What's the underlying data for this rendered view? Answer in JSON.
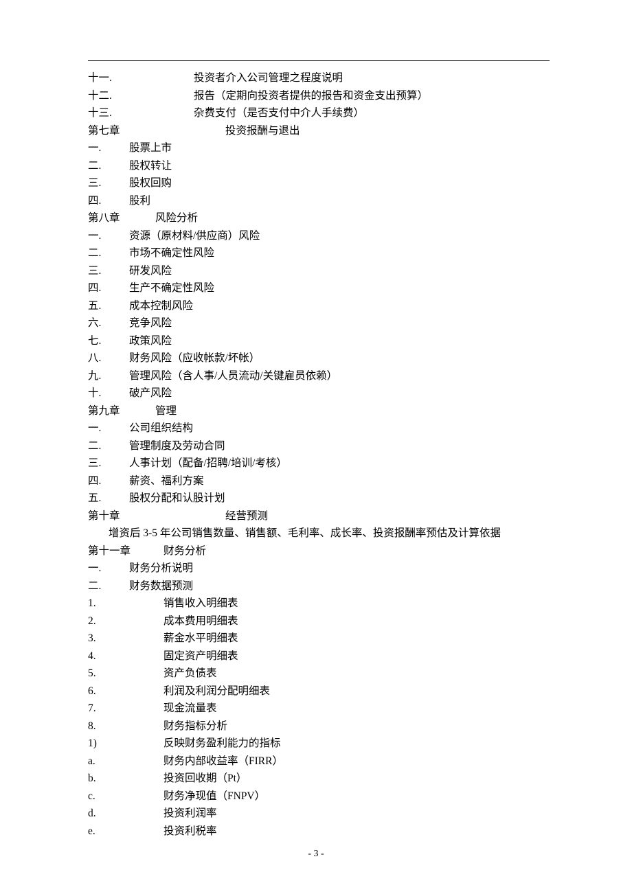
{
  "lines": [
    {
      "num": "十一.",
      "numClass": "wide-num",
      "text": "投资者介入公司管理之程度说明"
    },
    {
      "num": "十二.",
      "numClass": "wide-num",
      "text": "报告（定期向投资者提供的报告和资金支出预算）"
    },
    {
      "num": "十三.",
      "numClass": "wide-num",
      "text": "杂费支付（是否支付中介人手续费）"
    },
    {
      "num": "第七章",
      "numClass": "chapter-lbl",
      "text": "投资报酬与退出"
    },
    {
      "num": "一.",
      "numClass": "num",
      "text": "股票上市"
    },
    {
      "num": "二.",
      "numClass": "num",
      "text": "股权转让"
    },
    {
      "num": "三.",
      "numClass": "num",
      "text": "股权回购"
    },
    {
      "num": "四.",
      "numClass": "num",
      "text": "股利"
    },
    {
      "num": "第八章",
      "numClass": "ch-num",
      "text": "风险分析"
    },
    {
      "num": "一.",
      "numClass": "num",
      "text": "资源（原材料/供应商）风险"
    },
    {
      "num": "二.",
      "numClass": "num",
      "text": "市场不确定性风险"
    },
    {
      "num": "三.",
      "numClass": "num",
      "text": "研发风险"
    },
    {
      "num": "四.",
      "numClass": "num",
      "text": "生产不确定性风险"
    },
    {
      "num": "五.",
      "numClass": "num",
      "text": "成本控制风险"
    },
    {
      "num": "六.",
      "numClass": "num",
      "text": "竞争风险"
    },
    {
      "num": "七.",
      "numClass": "num",
      "text": "政策风险"
    },
    {
      "num": "八.",
      "numClass": "num",
      "text": "财务风险（应收帐款/坏帐）"
    },
    {
      "num": "九.",
      "numClass": "num",
      "text": "管理风险（含人事/人员流动/关键雇员依赖）"
    },
    {
      "num": "十.",
      "numClass": "num",
      "text": "破产风险"
    },
    {
      "num": "第九章",
      "numClass": "ch-num",
      "text": "管理"
    },
    {
      "num": "一.",
      "numClass": "num",
      "text": "公司组织结构"
    },
    {
      "num": "二.",
      "numClass": "num",
      "text": "管理制度及劳动合同"
    },
    {
      "num": "三.",
      "numClass": "num",
      "text": "人事计划（配备/招聘/培训/考核）"
    },
    {
      "num": "四.",
      "numClass": "num",
      "text": "薪资、福利方案"
    },
    {
      "num": "五.",
      "numClass": "num",
      "text": "股权分配和认股计划"
    },
    {
      "num": "第十章",
      "numClass": "chapter-lbl",
      "text": "经营预测"
    },
    {
      "num": "",
      "numClass": "",
      "text": "增资后 3-5 年公司销售数量、销售额、毛利率、成长率、投资报酬率预估及计算依据",
      "rowClass": "indent"
    },
    {
      "num": "第十一章",
      "numClass": "sub-num",
      "text": "财务分析"
    },
    {
      "num": "一.",
      "numClass": "num",
      "text": "财务分析说明"
    },
    {
      "num": "二.",
      "numClass": "num",
      "text": "财务数据预测"
    },
    {
      "num": "1.",
      "numClass": "sub-num",
      "text": "销售收入明细表"
    },
    {
      "num": "2.",
      "numClass": "sub-num",
      "text": "成本费用明细表"
    },
    {
      "num": "3.",
      "numClass": "sub-num",
      "text": "薪金水平明细表"
    },
    {
      "num": "4.",
      "numClass": "sub-num",
      "text": "固定资产明细表"
    },
    {
      "num": "5.",
      "numClass": "sub-num",
      "text": "资产负债表"
    },
    {
      "num": "6.",
      "numClass": "sub-num",
      "text": "利润及利润分配明细表"
    },
    {
      "num": "7.",
      "numClass": "sub-num",
      "text": "现金流量表"
    },
    {
      "num": "8.",
      "numClass": "sub-num",
      "text": "财务指标分析"
    },
    {
      "num": "1)",
      "numClass": "sub-num",
      "text": "反映财务盈利能力的指标"
    },
    {
      "num": "a.",
      "numClass": "sub-num",
      "text": "财务内部收益率（FIRR）"
    },
    {
      "num": "b.",
      "numClass": "sub-num",
      "text": "投资回收期（Pt）"
    },
    {
      "num": "c.",
      "numClass": "sub-num",
      "text": "财务净现值（FNPV）"
    },
    {
      "num": "d.",
      "numClass": "sub-num",
      "text": "投资利润率"
    },
    {
      "num": "e.",
      "numClass": "sub-num",
      "text": "投资利税率"
    }
  ],
  "footer": "- 3 -"
}
